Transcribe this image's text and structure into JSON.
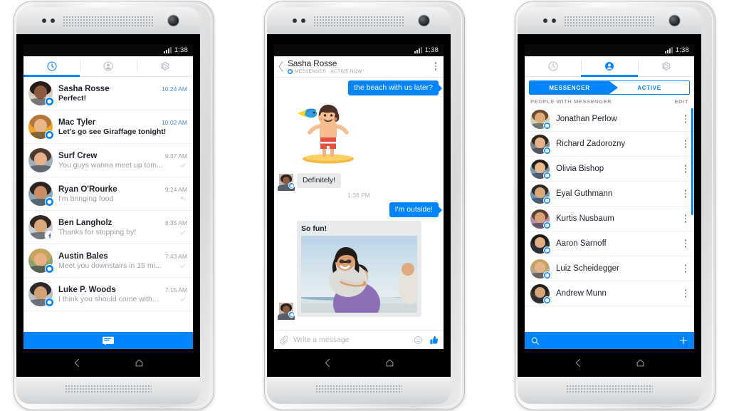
{
  "status_bar": {
    "time": "1:38"
  },
  "phone1": {
    "name": "recent-threads-screen",
    "tabs": [
      {
        "id": "recent",
        "icon": "clock-icon",
        "active": true
      },
      {
        "id": "contacts",
        "icon": "person-icon",
        "active": false
      },
      {
        "id": "settings",
        "icon": "gear-icon",
        "active": false
      }
    ],
    "threads": [
      {
        "name": "Sasha Rosse",
        "snippet": "Perfect!",
        "time": "10:24 AM",
        "unread": true,
        "badge": "messenger",
        "status": "",
        "skin": "#8d5a3e",
        "hair": "#241a16",
        "bg": "#d8cdc2"
      },
      {
        "name": "Mac Tyler",
        "snippet": "Let's go see Giraffage tonight!",
        "time": "10:02 AM",
        "unread": true,
        "badge": "messenger",
        "status": "",
        "skin": "#e9b68c",
        "hair": "#b4763a",
        "bg": "#f0a525"
      },
      {
        "name": "Surf Crew",
        "snippet": "You guys wanna meet up tom...",
        "time": "9:37 AM",
        "unread": false,
        "badge": "none",
        "status": "check",
        "skin": "#e4b188",
        "hair": "#4a3a2c",
        "bg": "#9fb0bd"
      },
      {
        "name": "Ryan O'Rourke",
        "snippet": "I'm bringing food",
        "time": "9:24 AM",
        "unread": false,
        "badge": "messenger",
        "status": "reply",
        "skin": "#c98d60",
        "hair": "#2b2420",
        "bg": "#8fa9bc"
      },
      {
        "name": "Ben Langholz",
        "snippet": "Thanks for stopping by!",
        "time": "8:35 AM",
        "unread": false,
        "badge": "facebook",
        "status": "check",
        "skin": "#dda878",
        "hair": "#332620",
        "bg": "#c9cfd3"
      },
      {
        "name": "Austin Bales",
        "snippet": "Meet you downstairs in 15 mi...",
        "time": "7:43 AM",
        "unread": false,
        "badge": "messenger",
        "status": "check",
        "skin": "#e8b183",
        "hair": "#c9a45e",
        "bg": "#8fa36a"
      },
      {
        "name": "Luke P. Woods",
        "snippet": "I think you should come with...",
        "time": "7:15 AM",
        "unread": false,
        "badge": "messenger",
        "status": "check",
        "skin": "#d3a072",
        "hair": "#2e2a2a",
        "bg": "#b9c2c9"
      }
    ],
    "compose_bar": {
      "icon": "new-message-icon"
    }
  },
  "phone2": {
    "name": "conversation-screen",
    "header": {
      "back_icon": "back-chevron-icon",
      "title": "Sasha Rosse",
      "subtitle": "MESSENGER · ACTIVE NOW",
      "menu_icon": "overflow-menu-icon"
    },
    "messages": [
      {
        "type": "text",
        "dir": "out",
        "text": "the beach with us later?"
      },
      {
        "type": "sticker",
        "dir": "in",
        "sticker": "surfer-sticker"
      },
      {
        "type": "text",
        "dir": "in",
        "text": "Definitely!",
        "avatar": true
      },
      {
        "type": "timestamp",
        "text": "1:38 PM"
      },
      {
        "type": "text",
        "dir": "out",
        "text": "I'm outside!"
      },
      {
        "type": "photo",
        "dir": "in",
        "caption": "So fun!",
        "avatar": true
      }
    ],
    "composer": {
      "attach_icon": "paperclip-icon",
      "placeholder": "Write a message",
      "emoji_icon": "emoji-smiley-icon",
      "like_icon": "thumbs-up-icon"
    }
  },
  "phone3": {
    "name": "contacts-screen",
    "tabs": [
      {
        "id": "recent",
        "icon": "clock-icon",
        "active": false
      },
      {
        "id": "contacts",
        "icon": "person-icon",
        "active": true
      },
      {
        "id": "settings",
        "icon": "gear-icon",
        "active": false
      }
    ],
    "segmented": {
      "left": "MESSENGER",
      "right": "ACTIVE",
      "selected": "MESSENGER"
    },
    "section": {
      "title": "PEOPLE WITH MESSENGER",
      "action": "EDIT"
    },
    "contacts": [
      {
        "name": "Jonathan Perlow",
        "skin": "#e0ab7c",
        "hair": "#6b4a2c",
        "bg": "#cfd6b8"
      },
      {
        "name": "Richard Zadorozny",
        "skin": "#e5b185",
        "hair": "#2c241f",
        "bg": "#7e868d"
      },
      {
        "name": "Olivia Bishop",
        "skin": "#e8b98f",
        "hair": "#241b17",
        "bg": "#7c97ad"
      },
      {
        "name": "Eyal Guthmann",
        "skin": "#dba87a",
        "hair": "#2d2823",
        "bg": "#6d94b3"
      },
      {
        "name": "Kurtis Nusbaum",
        "skin": "#d9a376",
        "hair": "#5a4030",
        "bg": "#b58fa8"
      },
      {
        "name": "Aaron Sarnoff",
        "skin": "#e0ae80",
        "hair": "#1d1a18",
        "bg": "#2c3038"
      },
      {
        "name": "Luiz Scheidegger",
        "skin": "#e6b489",
        "hair": "#c8a060",
        "bg": "#b6a98f"
      },
      {
        "name": "Andrew Munn",
        "skin": "#d9a478",
        "hair": "#241e1a",
        "bg": "#3a3330"
      }
    ],
    "bottom_bar": {
      "search_icon": "search-icon",
      "add_icon": "plus-icon"
    }
  },
  "nav": {
    "back_icon": "back-icon",
    "home_icon": "home-icon"
  },
  "colors": {
    "accent": "#0084ff",
    "text": "#1d2129",
    "muted": "#9aa0a6"
  }
}
